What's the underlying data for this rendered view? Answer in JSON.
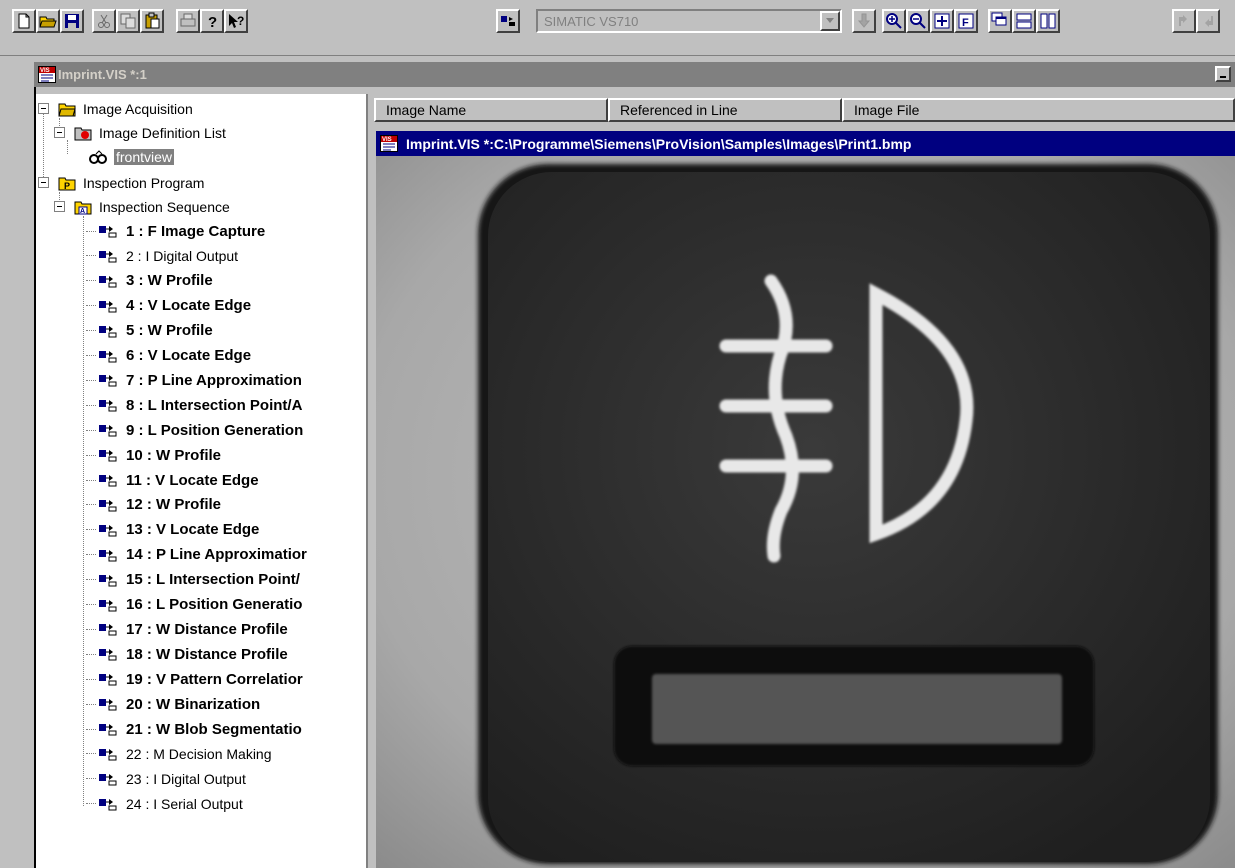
{
  "toolbar": {
    "device_selector": "SIMATIC VS710",
    "buttons": [
      "new-file-icon",
      "open-folder-icon",
      "save-icon",
      "cut-icon",
      "copy-icon",
      "paste-icon",
      "print-icon",
      "help-icon",
      "context-help-icon",
      "step-icon",
      "download-icon",
      "zoom-in-icon",
      "zoom-out-icon",
      "fit-icon",
      "full-icon",
      "cascade-icon",
      "tile-horizontal-icon",
      "tile-vertical-icon",
      "up-icon",
      "down-icon"
    ]
  },
  "document_window": {
    "title": "Imprint.VIS *:1",
    "icon": "vis-document-icon"
  },
  "tree": {
    "image_acquisition": "Image Acquisition",
    "image_definition_list": "Image Definition List",
    "frontview": "frontview",
    "inspection_program": "Inspection Program",
    "inspection_sequence": "Inspection Sequence",
    "steps": [
      {
        "label": "1 : F Image Capture",
        "bold": true
      },
      {
        "label": "2 : I Digital Output",
        "bold": false
      },
      {
        "label": "3 : W Profile",
        "bold": true
      },
      {
        "label": "4 : V Locate Edge",
        "bold": true
      },
      {
        "label": "5 : W Profile",
        "bold": true
      },
      {
        "label": "6 : V Locate Edge",
        "bold": true
      },
      {
        "label": "7 : P Line Approximation",
        "bold": true
      },
      {
        "label": "8 : L Intersection Point/A",
        "bold": true
      },
      {
        "label": "9 : L Position Generation",
        "bold": true
      },
      {
        "label": "10 : W Profile",
        "bold": true
      },
      {
        "label": "11 : V Locate Edge",
        "bold": true
      },
      {
        "label": "12 : W Profile",
        "bold": true
      },
      {
        "label": "13 : V Locate Edge",
        "bold": true
      },
      {
        "label": "14 : P Line Approximatior",
        "bold": true
      },
      {
        "label": "15 : L Intersection Point/",
        "bold": true
      },
      {
        "label": "16 : L Position Generatio",
        "bold": true
      },
      {
        "label": "17 : W Distance Profile",
        "bold": true
      },
      {
        "label": "18 : W Distance Profile",
        "bold": true
      },
      {
        "label": "19 : V Pattern Correlatior",
        "bold": true
      },
      {
        "label": "20 : W Binarization",
        "bold": true
      },
      {
        "label": "21 : W Blob Segmentatio",
        "bold": true
      },
      {
        "label": "22 : M Decision Making",
        "bold": false
      },
      {
        "label": "23 : I Digital Output",
        "bold": false
      },
      {
        "label": "24 : I Serial Output",
        "bold": false
      }
    ]
  },
  "list": {
    "columns": [
      "Image Name",
      "Referenced in Line",
      "Image File"
    ]
  },
  "image_window": {
    "title": "Imprint.VIS *:C:\\Programme\\Siemens\\ProVision\\Samples\\Images\\Print1.bmp"
  },
  "colors": {
    "window_bg": "#c0c0c0",
    "active_title": "#000080",
    "inactive_title": "#808080"
  }
}
